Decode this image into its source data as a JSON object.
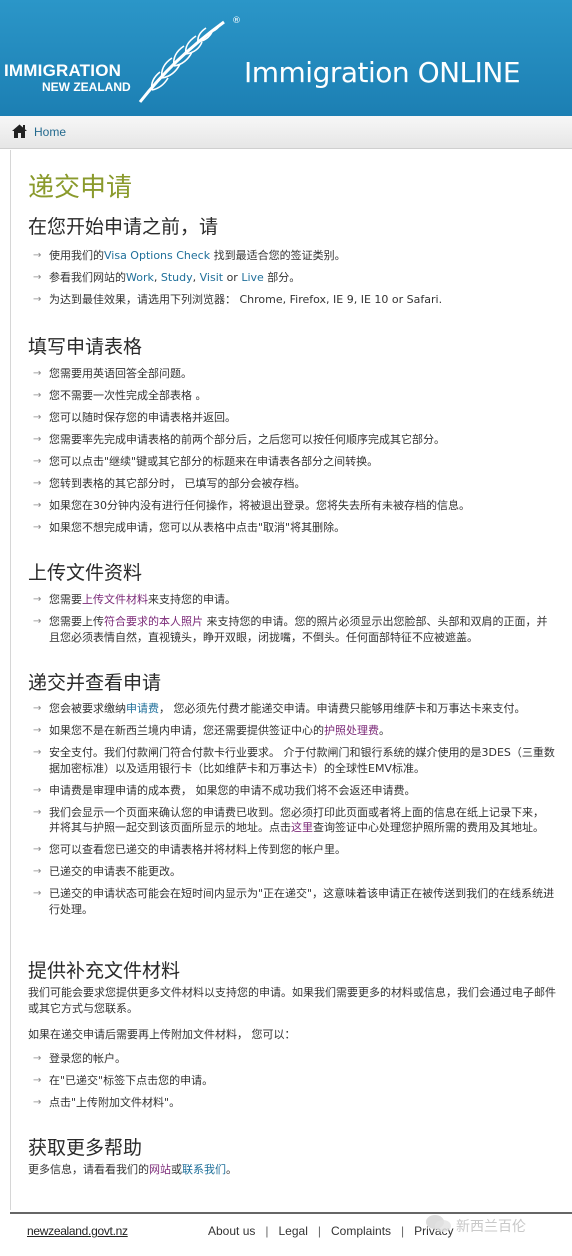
{
  "header": {
    "logo_main": "IMMIGRATION",
    "logo_sub": "NEW ZEALAND",
    "logo_reg": "®",
    "site_title": "Immigration ONLINE"
  },
  "breadcrumb": {
    "home": "Home"
  },
  "page": {
    "title": "递交申请",
    "sections": {
      "before": {
        "heading": "在您开始申请之前，请",
        "i1_a": "使用我们的",
        "i1_link": "Visa Options Check",
        "i1_b": " 找到最适合您的签证类别。",
        "i2_a": "参看我们网站的",
        "i2_work": "Work",
        "i2_comma1": ", ",
        "i2_study": "Study",
        "i2_comma2": ", ",
        "i2_visit": "Visit",
        "i2_or": " or ",
        "i2_live": "Live",
        "i2_b": " 部分。",
        "i3": "为达到最佳效果，请选用下列浏览器： Chrome, Firefox, IE 9, IE 10 or Safari."
      },
      "fill": {
        "heading": "填写申请表格",
        "items": [
          "您需要用英语回答全部问题。",
          "您不需要一次性完成全部表格 。",
          "您可以随时保存您的申请表格并返回。",
          "您需要率先完成申请表格的前两个部分后，之后您可以按任何顺序完成其它部分。",
          "您可以点击\"继续\"键或其它部分的标题来在申请表各部分之间转换。",
          "您转到表格的其它部分时， 已填写的部分会被存档。",
          "如果您在30分钟内没有进行任何操作，将被退出登录。您将失去所有未被存档的信息。",
          "如果您不想完成申请，您可以从表格中点击\"取消\"将其删除。"
        ]
      },
      "upload": {
        "heading": "上传文件资料",
        "i1_a": "您需要",
        "i1_link": "上传文件材料",
        "i1_b": "来支持您的申请。",
        "i2_a": "您需要上传",
        "i2_link": "符合要求的本人照片",
        "i2_b": " 来支持您的申请。您的照片必须显示出您脸部、头部和双肩的正面，并且您必须表情自然，直视镜头，睁开双眼，闭拢嘴，不倒头。任何面部特征不应被遮盖。"
      },
      "submit": {
        "heading": "递交并查看申请",
        "i1_a": "您会被要求缴纳",
        "i1_link": "申请费",
        "i1_b": "， 您必须先付费才能递交申请。申请费只能够用维萨卡和万事达卡来支付。",
        "i2_a": "如果您不是在新西兰境内申请，您还需要提供签证中心的",
        "i2_link": "护照处理费",
        "i2_b": "。",
        "i3": "安全支付。我们付款闸门符合付款卡行业要求。 介于付款闸门和银行系统的媒介使用的是3DES（三重数据加密标准）以及适用银行卡（比如维萨卡和万事达卡）的全球性EMV标准。",
        "i4": "申请费是审理申请的成本费， 如果您的申请不成功我们将不会返还申请费。",
        "i5_a": "我们会显示一个页面来确认您的申请费已收到。您必须打印此页面或者将上面的信息在纸上记录下来， 并将其与护照一起交到该页面所显示的地址。点击",
        "i5_link": "这里",
        "i5_b": "查询签证中心处理您护照所需的费用及其地址。",
        "i6": "您可以查看您已递交的申请表格并将材料上传到您的帐户里。",
        "i7": "已递交的申请表不能更改。",
        "i8": "已递交的申请状态可能会在短时间内显示为\"正在递交\"，这意味着该申请正在被传送到我们的在线系统进行处理。"
      },
      "supplement": {
        "heading": "提供补充文件材料",
        "para1": "我们可能会要求您提供更多文件材料以支持您的申请。如果我们需要更多的材料或信息，我们会通过电子邮件或其它方式与您联系。",
        "para2": "如果在递交申请后需要再上传附加文件材料， 您可以：",
        "items": [
          "登录您的帐户。",
          "在\"已递交\"标签下点击您的申请。",
          "点击\"上传附加文件材料\"。"
        ]
      },
      "help": {
        "heading": "获取更多帮助",
        "text_a": "更多信息，请看看我们的",
        "link1": "网站",
        "or": "或",
        "link2": "联系我们",
        "text_b": "。"
      }
    }
  },
  "footer": {
    "logo": "newzealand.govt.nz",
    "links": [
      "About us",
      "Legal",
      "Complaints",
      "Privacy"
    ],
    "sep": "|"
  },
  "watermark": {
    "text": "新西兰百伦"
  },
  "colors": {
    "header_bg": "#1f87bb",
    "title_green": "#8a9a2c",
    "link_blue": "#1f6f9a",
    "link_purple": "#7b2a78"
  }
}
